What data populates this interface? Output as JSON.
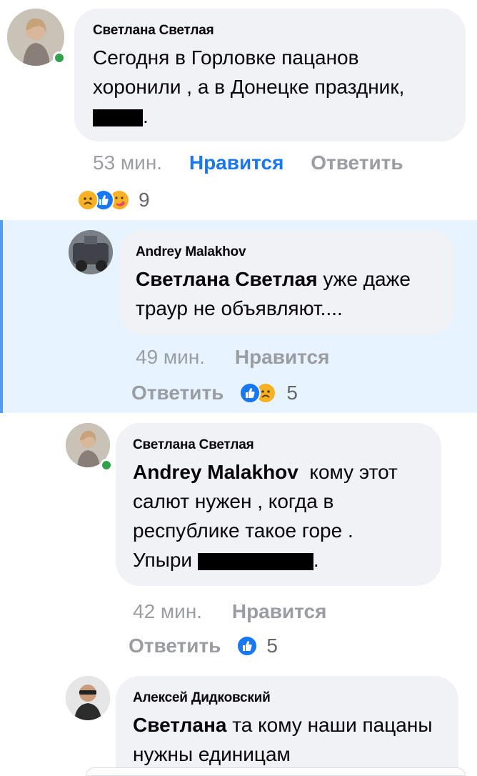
{
  "comments": [
    {
      "author": "Светлана Светлая",
      "text": "Сегодня в Горловке пацанов хоронили , а в Донецке праздник,",
      "text_end": ".",
      "time": "53 мин.",
      "like_label": "Нравится",
      "reply_label": "Ответить",
      "reactions": [
        "sad",
        "like",
        "care"
      ],
      "reaction_count": "9",
      "online": true
    },
    {
      "author": "Andrey Malakhov",
      "mention": "Светлана Светлая",
      "text": " уже даже траур не объявляют....",
      "time": "49 мин.",
      "like_label": "Нравится",
      "reply_label": "Ответить",
      "reactions": [
        "like",
        "sad"
      ],
      "reaction_count": "5",
      "highlighted": true
    },
    {
      "author": "Светлана Светлая",
      "mention": "Andrey Malakhov",
      "text": "  кому этот салют нужен , когда в республике такое горе .",
      "text2": "Упыри",
      "text_end": ".",
      "time": "42 мин.",
      "like_label": "Нравится",
      "reply_label": "Ответить",
      "reactions": [
        "like"
      ],
      "reaction_count": "5",
      "online": true
    },
    {
      "author": "Алексей Дидковский",
      "mention": "Светлана",
      "text": " та кому наши пацаны нужны единицам"
    }
  ],
  "colors": {
    "bubble": "#f0f2f5",
    "highlight": "#e7f3ff",
    "highlight_border": "#4f9df7",
    "like_active": "#1877f2",
    "meta": "#9a9da2",
    "online": "#31a24c"
  }
}
